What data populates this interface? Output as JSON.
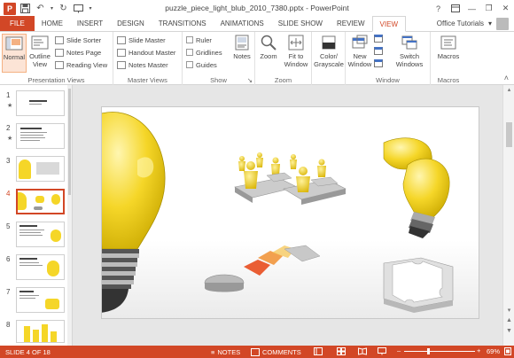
{
  "window": {
    "title": "puzzle_piece_light_blub_2010_7380.pptx - PowerPoint",
    "help": "?",
    "minimize": "—",
    "restore": "❐",
    "close": "✕"
  },
  "qat": {
    "app_icon": "P",
    "save_icon": "floppy-disk",
    "undo_icon": "undo-arrow",
    "redo_icon": "redo-arrow",
    "start_icon": "slideshow-start"
  },
  "tabs": [
    {
      "label": "FILE"
    },
    {
      "label": "HOME"
    },
    {
      "label": "INSERT"
    },
    {
      "label": "DESIGN"
    },
    {
      "label": "TRANSITIONS"
    },
    {
      "label": "ANIMATIONS"
    },
    {
      "label": "SLIDE SHOW"
    },
    {
      "label": "REVIEW"
    },
    {
      "label": "VIEW"
    }
  ],
  "account": {
    "label": "Office Tutorials",
    "caret": "▾"
  },
  "ribbon": {
    "presentation_views": {
      "label": "Presentation Views",
      "normal": "Normal",
      "outline": "Outline View",
      "slide_sorter": "Slide Sorter",
      "notes_page": "Notes Page",
      "reading_view": "Reading View"
    },
    "master_views": {
      "label": "Master Views",
      "slide_master": "Slide Master",
      "handout_master": "Handout Master",
      "notes_master": "Notes Master"
    },
    "show": {
      "label": "Show",
      "ruler": "Ruler",
      "gridlines": "Gridlines",
      "guides": "Guides",
      "notes": "Notes",
      "launcher": "↘"
    },
    "zoom": {
      "label": "Zoom",
      "zoom": "Zoom",
      "fit": "Fit to Window"
    },
    "color": {
      "label": "Color/ Grayscale",
      "caret": "▾"
    },
    "window": {
      "label": "Window",
      "new_window": "New Window",
      "switch_windows": "Switch Windows",
      "caret": "▾"
    },
    "macros": {
      "label": "Macros",
      "macros": "Macros"
    },
    "collapse": "˄"
  },
  "thumbnails": [
    {
      "num": "1",
      "star": "★"
    },
    {
      "num": "2",
      "star": "★"
    },
    {
      "num": "3",
      "star": ""
    },
    {
      "num": "4",
      "star": ""
    },
    {
      "num": "5",
      "star": ""
    },
    {
      "num": "6",
      "star": ""
    },
    {
      "num": "7",
      "star": ""
    },
    {
      "num": "8",
      "star": ""
    }
  ],
  "status": {
    "slide_info": "SLIDE 4 OF 18",
    "notes": "NOTES",
    "comments": "COMMENTS",
    "zoom_minus": "–",
    "zoom_plus": "+",
    "zoom_level": "69%",
    "zoom_fraction": 0.69
  },
  "colors": {
    "accent": "#d24726",
    "bulb_yellow": "#f5d628"
  }
}
